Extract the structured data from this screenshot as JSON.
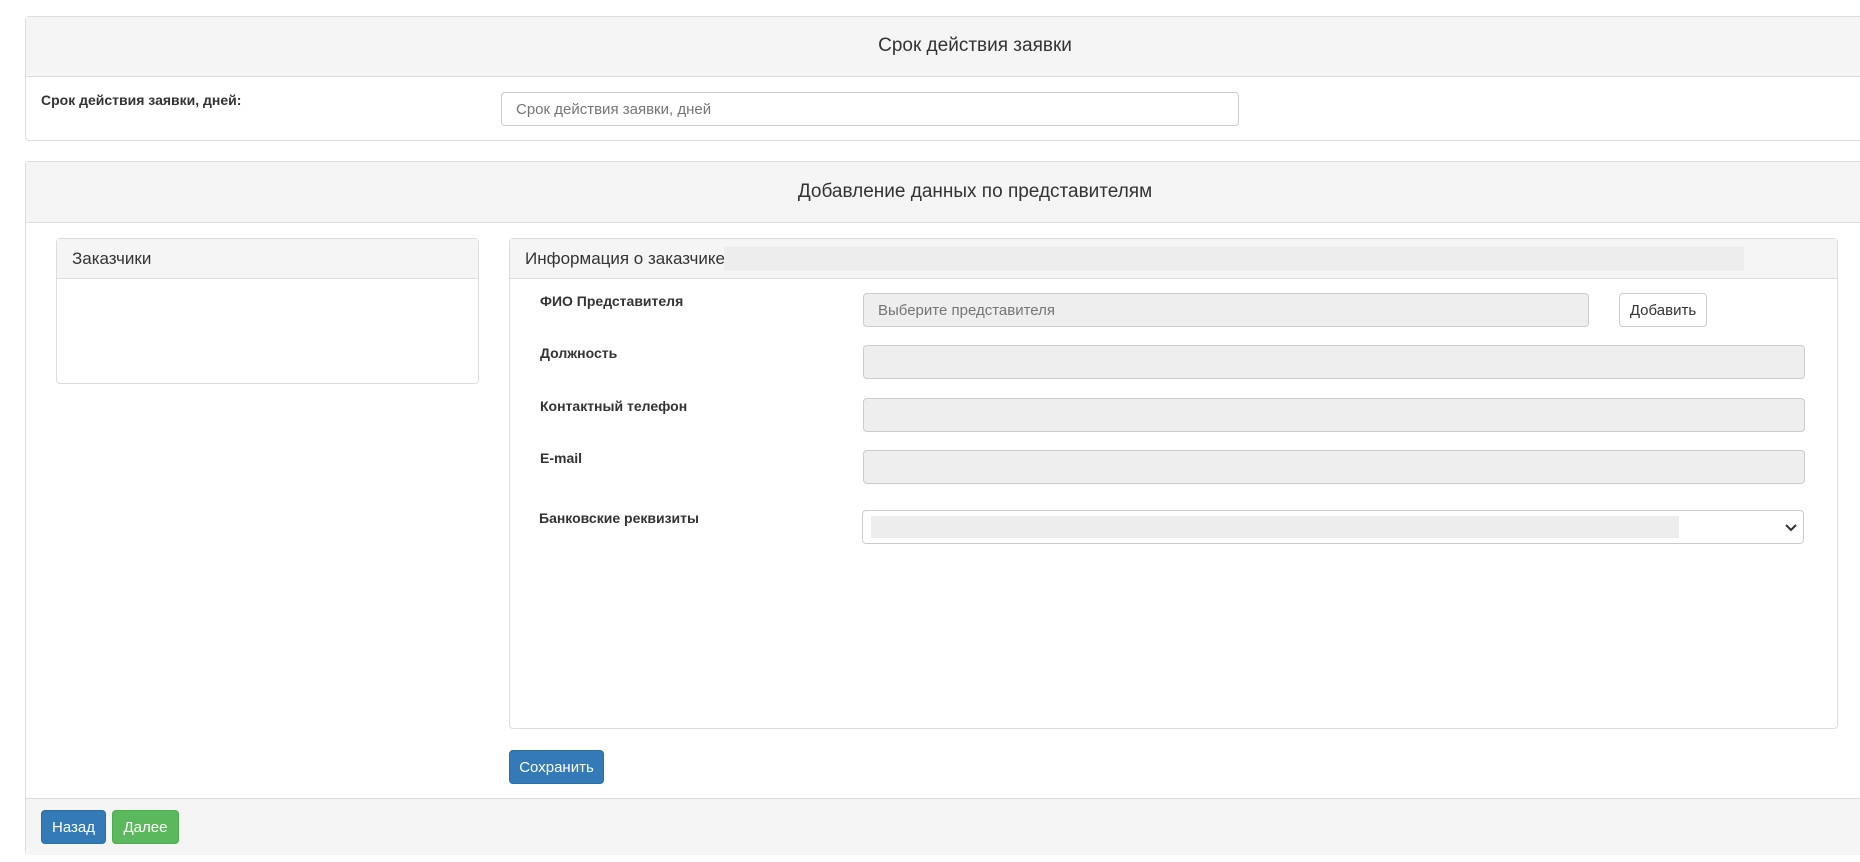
{
  "validity": {
    "heading": "Срок действия заявки",
    "field_label": "Срок действия заявки, дней:",
    "field_value": "",
    "field_placeholder": "Срок действия заявки, дней"
  },
  "representatives": {
    "heading": "Добавление данных по представителям",
    "customers_panel_title": "Заказчики",
    "info_panel_title": "Информация о заказчике -",
    "fields": {
      "fio_label": "ФИО Представителя",
      "fio_placeholder": "Выберите представителя",
      "add_button": "Добавить",
      "position_label": "Должность",
      "phone_label": "Контактный телефон",
      "email_label": "E-mail",
      "bank_label": "Банковские реквизиты"
    },
    "save_button": "Сохранить"
  },
  "footer": {
    "back_button": "Назад",
    "next_button": "Далее"
  }
}
